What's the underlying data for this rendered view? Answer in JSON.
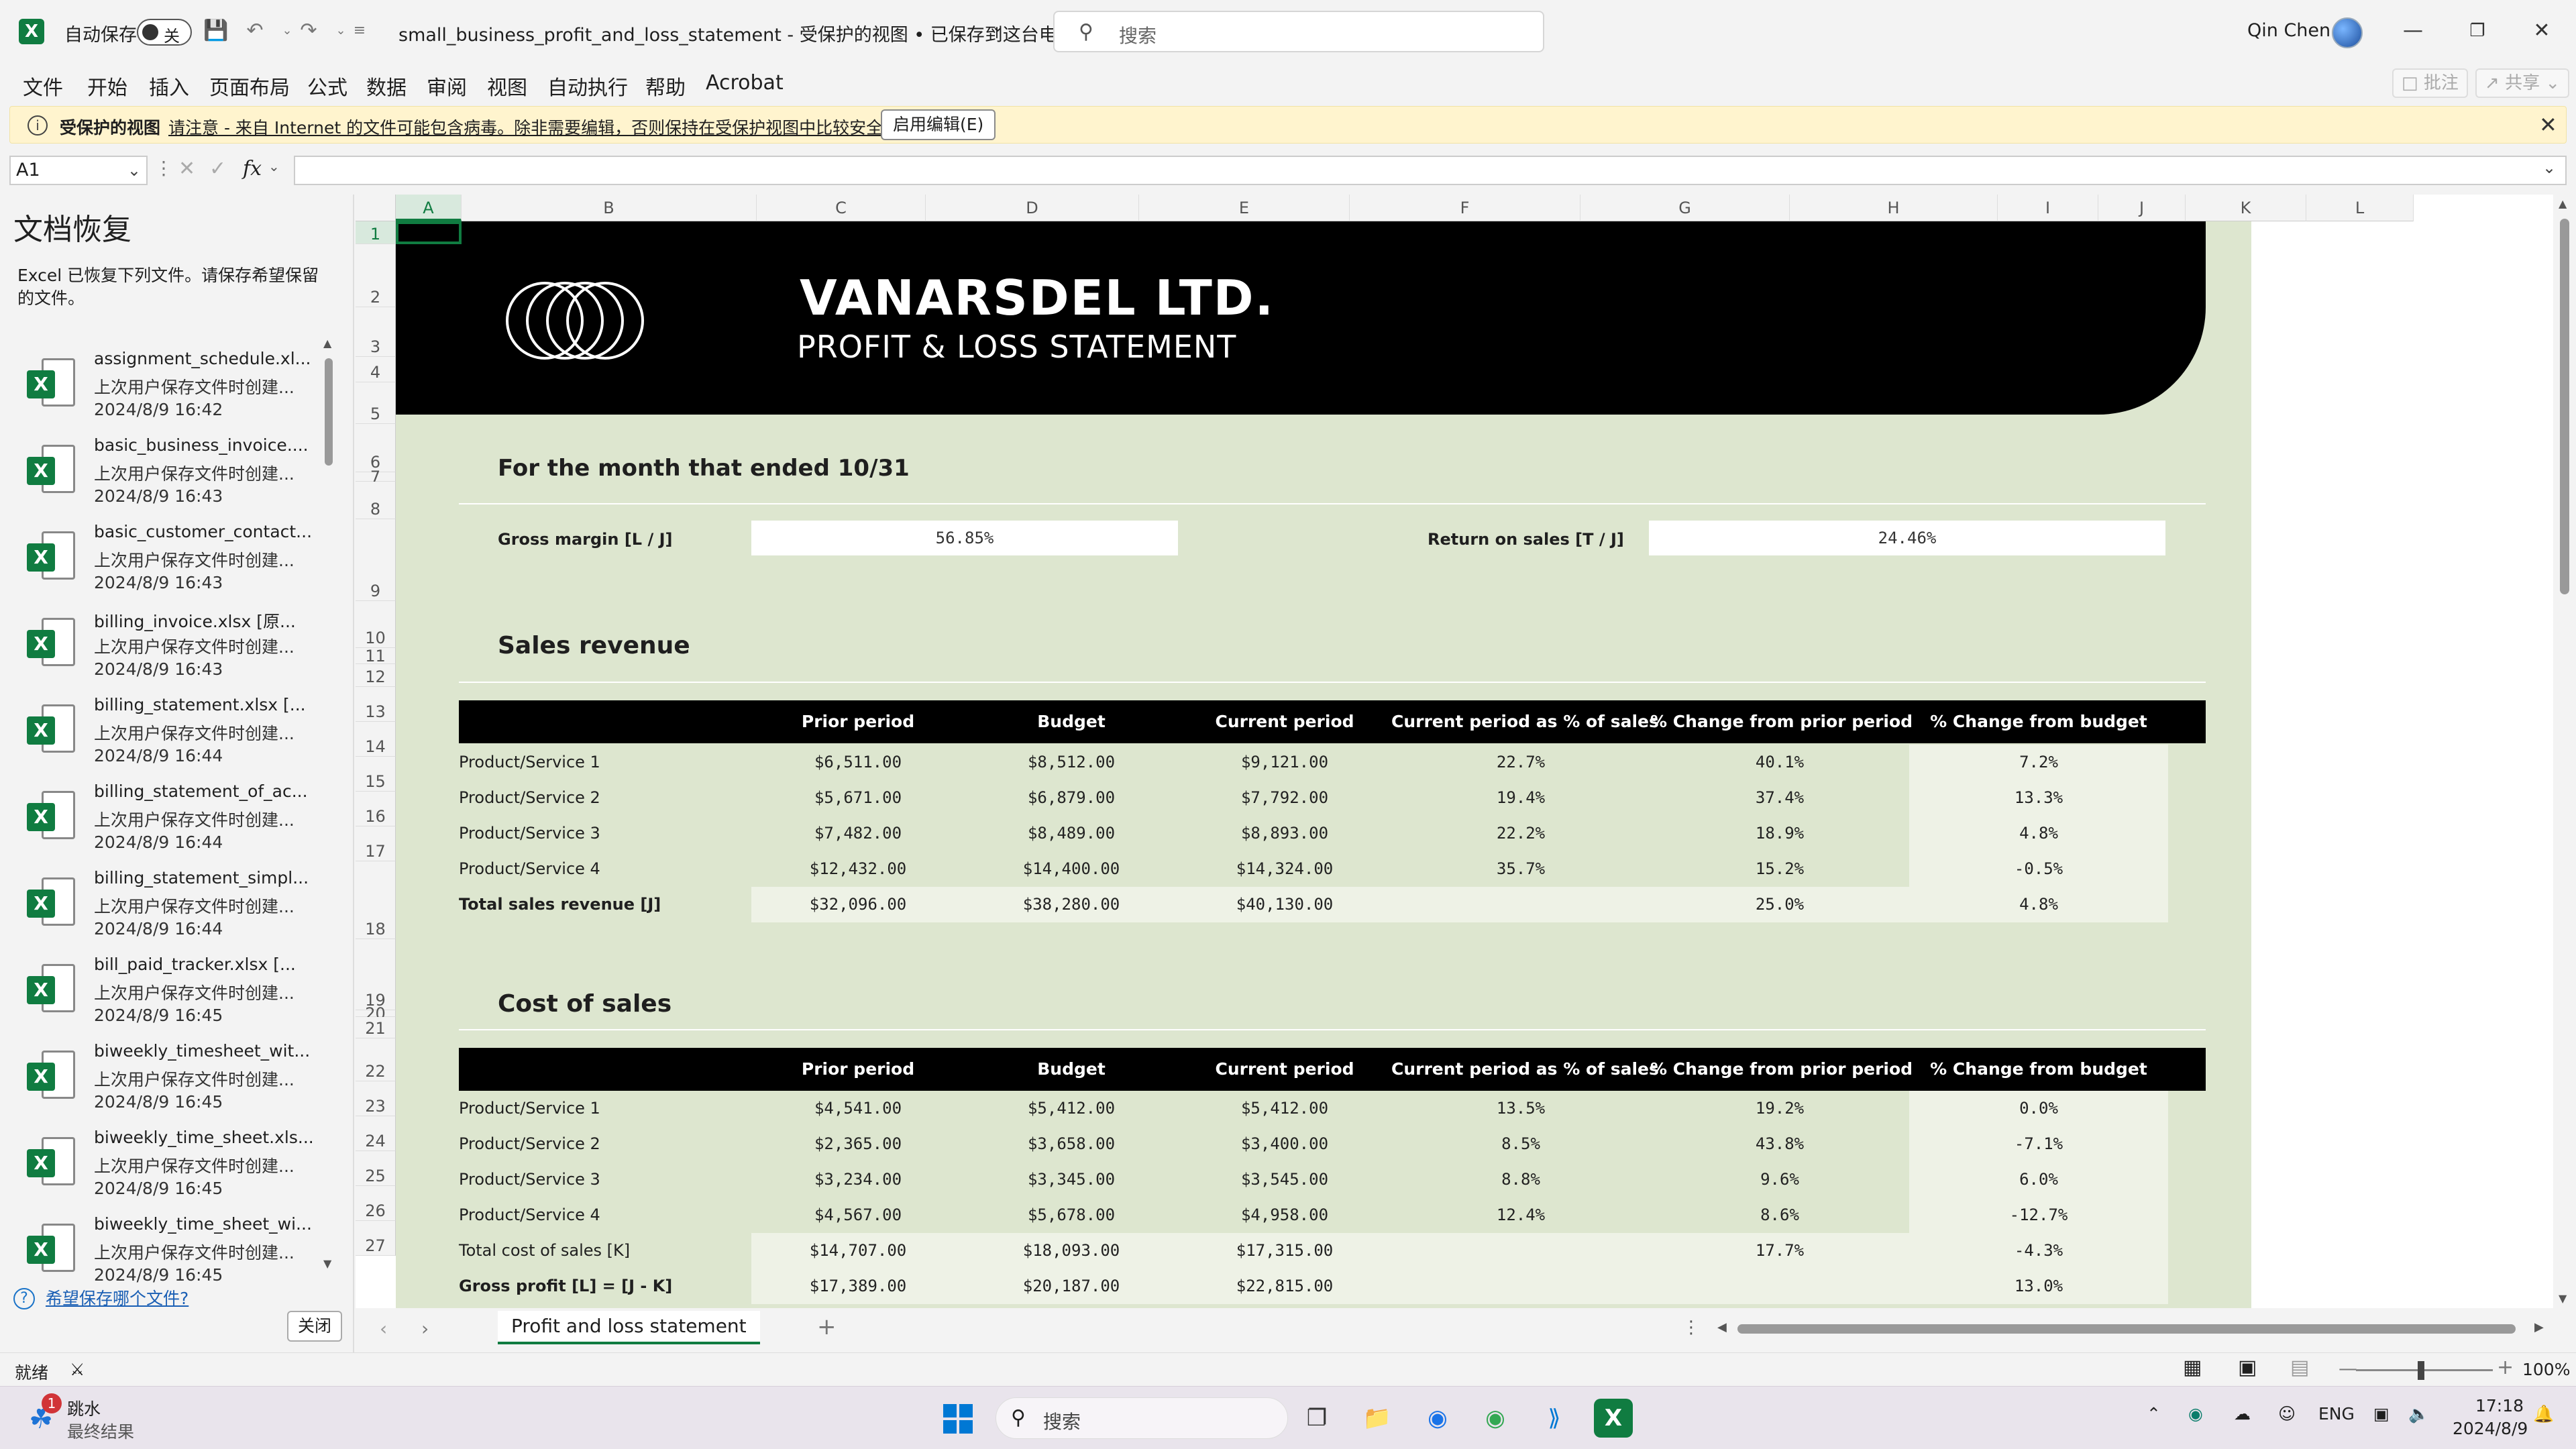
{
  "titlebar": {
    "autosave_label": "自动保存",
    "autosave_state": "关",
    "filename": "small_business_profit_and_loss_statement  -  受保护的视图 • 已保存到这台电脑",
    "search_placeholder": "搜索",
    "user_name": "Qin Chen"
  },
  "menu": {
    "items": [
      "文件",
      "开始",
      "插入",
      "页面布局",
      "公式",
      "数据",
      "审阅",
      "视图",
      "自动执行",
      "帮助",
      "Acrobat"
    ],
    "comment_label": "批注",
    "share_label": "共享"
  },
  "protected_bar": {
    "title": "受保护的视图",
    "message": "请注意 - 来自 Internet 的文件可能包含病毒。除非需要编辑，否则保持在受保护视图中比较安全。",
    "enable_button": "启用编辑(E)"
  },
  "formula_bar": {
    "name_box": "A1",
    "fx": "fx",
    "formula": ""
  },
  "recovery": {
    "title": "文档恢复",
    "description": "Excel 已恢复下列文件。请保存希望保留的文件。",
    "files": [
      {
        "name": "assignment_schedule.xl...",
        "desc": "上次用户保存文件时创建...",
        "date": "2024/8/9 16:42"
      },
      {
        "name": "basic_business_invoice....",
        "desc": "上次用户保存文件时创建...",
        "date": "2024/8/9 16:43"
      },
      {
        "name": "basic_customer_contact...",
        "desc": "上次用户保存文件时创建...",
        "date": "2024/8/9 16:43"
      },
      {
        "name": "billing_invoice.xlsx  [原...",
        "desc": "上次用户保存文件时创建...",
        "date": "2024/8/9 16:43"
      },
      {
        "name": "billing_statement.xlsx  [...",
        "desc": "上次用户保存文件时创建...",
        "date": "2024/8/9 16:44"
      },
      {
        "name": "billing_statement_of_ac...",
        "desc": "上次用户保存文件时创建...",
        "date": "2024/8/9 16:44"
      },
      {
        "name": "billing_statement_simpl...",
        "desc": "上次用户保存文件时创建...",
        "date": "2024/8/9 16:44"
      },
      {
        "name": "bill_paid_tracker.xlsx  [...",
        "desc": "上次用户保存文件时创建...",
        "date": "2024/8/9 16:45"
      },
      {
        "name": "biweekly_timesheet_wit...",
        "desc": "上次用户保存文件时创建...",
        "date": "2024/8/9 16:45"
      },
      {
        "name": "biweekly_time_sheet.xls...",
        "desc": "上次用户保存文件时创建...",
        "date": "2024/8/9 16:45"
      },
      {
        "name": "biweekly_time_sheet_wi...",
        "desc": "上次用户保存文件时创建...",
        "date": "2024/8/9 16:45"
      }
    ],
    "help_link": "希望保存哪个文件?",
    "close_button": "关闭"
  },
  "grid": {
    "columns": [
      "A",
      "B",
      "C",
      "D",
      "E",
      "F",
      "G",
      "H",
      "I",
      "J",
      "K",
      "L"
    ],
    "rows": [
      "1",
      "2",
      "3",
      "4",
      "5",
      "6",
      "7",
      "8",
      "9",
      "10",
      "11",
      "12",
      "13",
      "14",
      "15",
      "16",
      "17",
      "18",
      "19",
      "20",
      "21",
      "22",
      "23",
      "24",
      "25",
      "26",
      "27"
    ]
  },
  "sheet": {
    "company": "VANARSDEL LTD.",
    "doc_title": "PROFIT & LOSS STATEMENT",
    "period": "For the month that ended 10/31",
    "gross_margin_label": "Gross margin  [L / J]",
    "gross_margin_value": "56.85%",
    "return_on_sales_label": "Return on sales  [T / J]",
    "return_on_sales_value": "24.46%",
    "headers": [
      "Prior period",
      "Budget",
      "Current period",
      "Current period as % of sales",
      "% Change from prior period",
      "% Change from budget"
    ],
    "sales": {
      "title": "Sales revenue",
      "rows": [
        {
          "label": "Product/Service 1",
          "prior": "$6,511.00",
          "budget": "$8,512.00",
          "current": "$9,121.00",
          "pct_sales": "22.7%",
          "chg_prior": "40.1%",
          "chg_budget": "7.2%"
        },
        {
          "label": "Product/Service 2",
          "prior": "$5,671.00",
          "budget": "$6,879.00",
          "current": "$7,792.00",
          "pct_sales": "19.4%",
          "chg_prior": "37.4%",
          "chg_budget": "13.3%"
        },
        {
          "label": "Product/Service 3",
          "prior": "$7,482.00",
          "budget": "$8,489.00",
          "current": "$8,893.00",
          "pct_sales": "22.2%",
          "chg_prior": "18.9%",
          "chg_budget": "4.8%"
        },
        {
          "label": "Product/Service 4",
          "prior": "$12,432.00",
          "budget": "$14,400.00",
          "current": "$14,324.00",
          "pct_sales": "35.7%",
          "chg_prior": "15.2%",
          "chg_budget": "-0.5%"
        }
      ],
      "total": {
        "label": "Total sales revenue  [J]",
        "prior": "$32,096.00",
        "budget": "$38,280.00",
        "current": "$40,130.00",
        "pct_sales": "",
        "chg_prior": "25.0%",
        "chg_budget": "4.8%"
      }
    },
    "cost": {
      "title": "Cost of sales",
      "rows": [
        {
          "label": "Product/Service 1",
          "prior": "$4,541.00",
          "budget": "$5,412.00",
          "current": "$5,412.00",
          "pct_sales": "13.5%",
          "chg_prior": "19.2%",
          "chg_budget": "0.0%"
        },
        {
          "label": "Product/Service 2",
          "prior": "$2,365.00",
          "budget": "$3,658.00",
          "current": "$3,400.00",
          "pct_sales": "8.5%",
          "chg_prior": "43.8%",
          "chg_budget": "-7.1%"
        },
        {
          "label": "Product/Service 3",
          "prior": "$3,234.00",
          "budget": "$3,345.00",
          "current": "$3,545.00",
          "pct_sales": "8.8%",
          "chg_prior": "9.6%",
          "chg_budget": "6.0%"
        },
        {
          "label": "Product/Service 4",
          "prior": "$4,567.00",
          "budget": "$5,678.00",
          "current": "$4,958.00",
          "pct_sales": "12.4%",
          "chg_prior": "8.6%",
          "chg_budget": "-12.7%"
        }
      ],
      "total": {
        "label": "Total cost of sales  [K]",
        "prior": "$14,707.00",
        "budget": "$18,093.00",
        "current": "$17,315.00",
        "pct_sales": "",
        "chg_prior": "17.7%",
        "chg_budget": "-4.3%"
      },
      "gross": {
        "label": "Gross profit  [L] = [J - K]",
        "prior": "$17,389.00",
        "budget": "$20,187.00",
        "current": "$22,815.00",
        "pct_sales": "",
        "chg_prior": "",
        "chg_budget": "13.0%"
      }
    }
  },
  "tabs": {
    "active": "Profit and loss statement"
  },
  "status": {
    "ready": "就绪",
    "zoom": "100%"
  },
  "taskbar": {
    "weather_title": "跳水",
    "weather_sub": "最终结果",
    "badge": "1",
    "search": "搜索",
    "lang": "ENG",
    "time": "17:18",
    "date": "2024/8/9"
  },
  "colors": {
    "excel_green": "#107c41",
    "sheet_bg": "#dde6cf",
    "banner": "#000000",
    "warning_bg": "#fff4ce"
  }
}
